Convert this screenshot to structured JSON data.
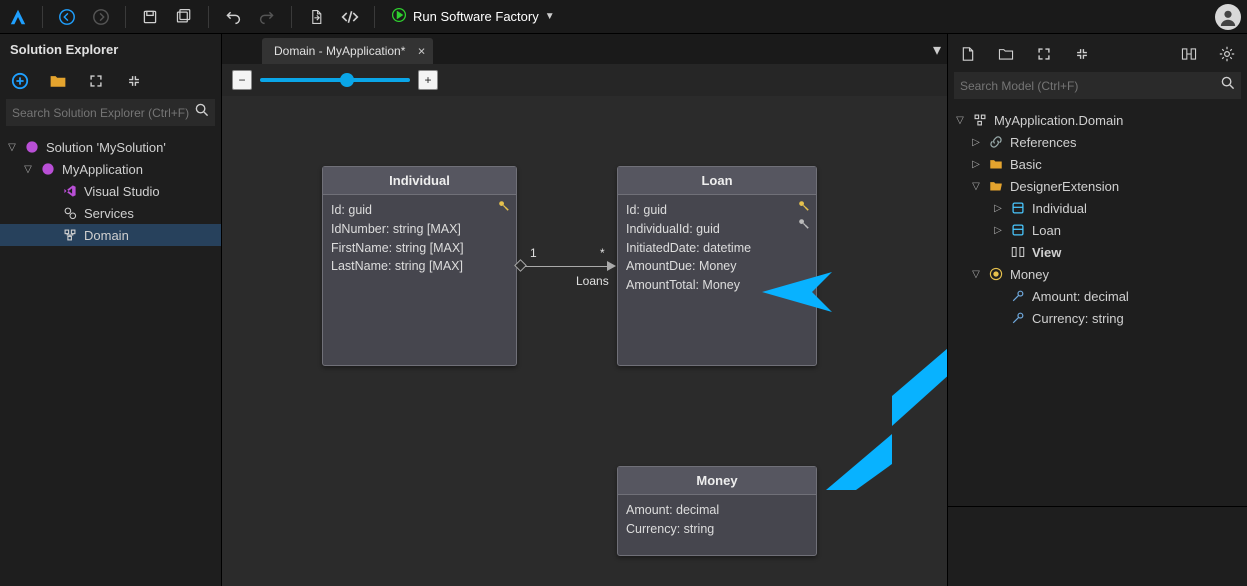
{
  "topbar": {
    "run_label": "Run Software Factory"
  },
  "left": {
    "title": "Solution Explorer",
    "search_placeholder": "Search Solution Explorer (Ctrl+F)",
    "solution_label": "Solution 'MySolution'",
    "app_label": "MyApplication",
    "vs_label": "Visual Studio",
    "services_label": "Services",
    "domain_label": "Domain"
  },
  "tab": {
    "title": "Domain - MyApplication*"
  },
  "entities": {
    "individual": {
      "title": "Individual",
      "fields": [
        "Id: guid",
        "IdNumber: string [MAX]",
        "FirstName: string [MAX]",
        "LastName: string [MAX]"
      ]
    },
    "loan": {
      "title": "Loan",
      "fields": [
        "Id: guid",
        "IndividualId: guid",
        "InitiatedDate: datetime",
        "AmountDue: Money",
        "AmountTotal: Money"
      ]
    },
    "money": {
      "title": "Money",
      "fields": [
        "Amount: decimal",
        "Currency: string"
      ]
    }
  },
  "assoc": {
    "left_mult": "1",
    "right_mult": "*",
    "role": "Loans"
  },
  "right": {
    "search_placeholder": "Search Model (Ctrl+F)",
    "root": "MyApplication.Domain",
    "references": "References",
    "basic": "Basic",
    "ext": "DesignerExtension",
    "individual": "Individual",
    "loan": "Loan",
    "view": "View",
    "money": "Money",
    "amount": "Amount: decimal",
    "currency": "Currency: string"
  }
}
